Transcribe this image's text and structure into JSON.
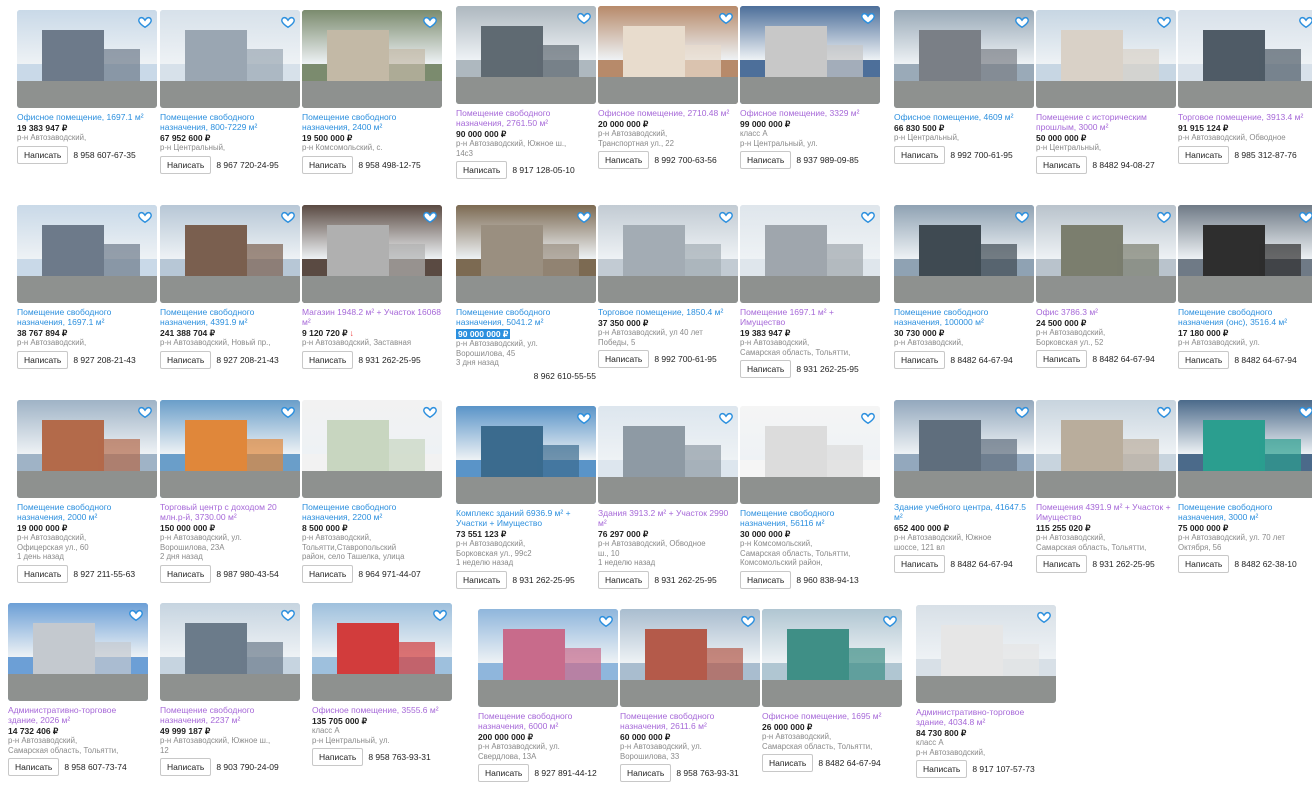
{
  "listings": [
    {
      "title": "Офисное помещение, 1697.1 м²",
      "price": "19 383 947 ₽",
      "meta": [
        "р-н Автозаводский,"
      ],
      "write": "Написать",
      "phone": "8 958 607-67-35",
      "visited": false
    },
    {
      "title": "Помещение свободного назначения, 800-7229 м²",
      "price": "67 952 600 ₽",
      "meta": [
        "р-н Центральный,"
      ],
      "write": "Написать",
      "phone": "8 967 720-24-95",
      "visited": false
    },
    {
      "title": "Помещение свободного назначения, 2400 м²",
      "price": "19 500 000 ₽",
      "meta": [
        "р-н Комсомольский, с."
      ],
      "write": "Написать",
      "phone": "8 958 498-12-75",
      "visited": false
    },
    {
      "title": "Помещение свободного назначения, 2761.50 м²",
      "price": "90 000 000 ₽",
      "meta": [
        "р-н Автозаводский, Южное ш.,",
        "14с3"
      ],
      "write": "Написать",
      "phone": "8 917 128-05-10",
      "visited": true
    },
    {
      "title": "Офисное помещение, 2710.48 м²",
      "price": "20 000 000 ₽",
      "meta": [
        "р-н Автозаводский,",
        "Транспортная ул., 22"
      ],
      "write": "Написать",
      "phone": "8 992 700-63-56",
      "visited": true
    },
    {
      "title": "Офисное помещение, 3329 м²",
      "price": "99 000 000 ₽",
      "meta": [
        "класс A",
        "р-н Центральный, ул."
      ],
      "write": "Написать",
      "phone": "8 937 989-09-85",
      "visited": true
    },
    {
      "title": "Офисное помещение, 4609 м²",
      "price": "66 830 500 ₽",
      "meta": [
        "р-н Центральный,"
      ],
      "write": "Написать",
      "phone": "8 992 700-61-95",
      "visited": false
    },
    {
      "title": "Помещение с историческим прошлым, 3000 м²",
      "price": "50 000 000 ₽",
      "meta": [
        "р-н Центральный,"
      ],
      "write": "Написать",
      "phone": "8 8482 94-08-27",
      "visited": true
    },
    {
      "title": "Торговое помещение, 3913.4 м²",
      "price": "91 915 124 ₽",
      "meta": [
        "р-н Автозаводский, Обводное"
      ],
      "write": "Написать",
      "phone": "8 985 312-87-76",
      "visited": true
    },
    {
      "title": "Помещение свободного назначения, 1697.1 м²",
      "price": "38 767 894 ₽",
      "meta": [
        "р-н Автозаводский,"
      ],
      "write": "Написать",
      "phone": "8 927 208-21-43",
      "visited": false
    },
    {
      "title": "Помещение свободного назначения, 4391.9 м²",
      "price": "241 388 704 ₽",
      "meta": [
        "р-н Автозаводский, Новый пр.,"
      ],
      "write": "Написать",
      "phone": "8 927 208-21-43",
      "visited": false
    },
    {
      "title": "Магазин 1948.2 м² + Участок 16068 м²",
      "price": "9 120 720 ₽",
      "drop": "↓",
      "meta": [
        "р-н Автозаводский, Заставная"
      ],
      "write": "Написать",
      "phone": "8 931 262-25-95",
      "visited": true
    },
    {
      "title": "Помещение свободного назначения, 5041.2 м²",
      "price": "90 000 000 ₽",
      "highlight": true,
      "meta": [
        "р-н Автозаводский, ул.",
        "Ворошилова, 45",
        "3 дня назад"
      ],
      "write": "",
      "phone": "8 962 610-55-55",
      "visited": false
    },
    {
      "title": "Торговое помещение, 1850.4 м²",
      "price": "37 350 000 ₽",
      "meta": [
        "р-н Автозаводский, ул 40 лет",
        "Победы, 5"
      ],
      "write": "Написать",
      "phone": "8 992 700-61-95",
      "visited": false
    },
    {
      "title": "Помещение 1697.1 м² + Имущество",
      "price": "19 383 947 ₽",
      "meta": [
        "р-н Автозаводский,",
        "Самарская область, Тольятти,"
      ],
      "write": "Написать",
      "phone": "8 931 262-25-95",
      "visited": true
    },
    {
      "title": "Помещение свободного назначения, 100000 м²",
      "price": "30 730 000 ₽",
      "meta": [
        "р-н Автозаводский,"
      ],
      "write": "Написать",
      "phone": "8 8482 64-67-94",
      "visited": false
    },
    {
      "title": "Офис 3786.3 м²",
      "price": "24 500 000 ₽",
      "meta": [
        "р-н Автозаводский,",
        "Борковская ул., 52"
      ],
      "write": "Написать",
      "phone": "8 8482 64-67-94",
      "visited": true
    },
    {
      "title": "Помещение свободного назначения (онс), 3516.4 м²",
      "price": "17 180 000 ₽",
      "meta": [
        "р-н Автозаводский, ул."
      ],
      "write": "Написать",
      "phone": "8 8482 64-67-94",
      "visited": false
    },
    {
      "title": "Помещение свободного назначения, 2000 м²",
      "price": "19 000 000 ₽",
      "meta": [
        "р-н Автозаводский,",
        "Офицерская ул., 60",
        "1 день назад"
      ],
      "write": "Написать",
      "phone": "8 927 211-55-63",
      "visited": false
    },
    {
      "title": "Торговый центр с доходом 20 млн.р-й, 3730.00 м²",
      "price": "150 000 000 ₽",
      "meta": [
        "р-н Автозаводский, ул.",
        "Ворошилова, 23А",
        "2 дня назад"
      ],
      "write": "Написать",
      "phone": "8 987 980-43-54",
      "visited": true
    },
    {
      "title": "Помещение свободного назначения, 2200 м²",
      "price": "8 500 000 ₽",
      "meta": [
        "р-н Автозаводский,",
        "Тольятти,Ставропольский",
        "район, село Ташелка, улица"
      ],
      "write": "Написать",
      "phone": "8 964 971-44-07",
      "visited": false
    },
    {
      "title": "Комплекс зданий 6936.9 м² + Участки + Имущество",
      "price": "73 551 123 ₽",
      "meta": [
        "р-н Автозаводский,",
        "Борковская ул., 99с2",
        "1 неделю назад"
      ],
      "write": "Написать",
      "phone": "8 931 262-25-95",
      "visited": false
    },
    {
      "title": "Здания 3913.2 м² + Участок 2990 м²",
      "price": "76 297 000 ₽",
      "meta": [
        "р-н Автозаводский, Обводное",
        "ш., 10",
        "1 неделю назад"
      ],
      "write": "Написать",
      "phone": "8 931 262-25-95",
      "visited": true
    },
    {
      "title": "Помещение свободного назначения, 56116 м²",
      "price": "30 000 000 ₽",
      "meta": [
        "р-н Комсомольский,",
        "Самарская область, Тольятти,",
        "Комсомольский район,"
      ],
      "write": "Написать",
      "phone": "8 960 838-94-13",
      "visited": false
    },
    {
      "title": "Здание учебного центра, 41647.5 м²",
      "price": "652 400 000 ₽",
      "meta": [
        "р-н Автозаводский, Южное",
        "шоссе, 121 вл"
      ],
      "write": "Написать",
      "phone": "8 8482 64-67-94",
      "visited": false
    },
    {
      "title": "Помещения 4391.9 м² + Участок + Имущество",
      "price": "115 255 020 ₽",
      "meta": [
        "р-н Автозаводский,",
        "Самарская область, Тольятти,"
      ],
      "write": "Написать",
      "phone": "8 931 262-25-95",
      "visited": true
    },
    {
      "title": "Помещение свободного назначения, 3000 м²",
      "price": "75 000 000 ₽",
      "meta": [
        "р-н Автозаводский, ул. 70 лет",
        "Октября, 56"
      ],
      "write": "Написать",
      "phone": "8 8482 62-38-10",
      "visited": false
    },
    {
      "title": "Административно-торговое здание, 2026 м²",
      "price": "14 732 406 ₽",
      "meta": [
        "р-н Автозаводский,",
        "Самарская область, Тольятти,"
      ],
      "write": "Написать",
      "phone": "8 958 607-73-74",
      "visited": true
    },
    {
      "title": "Помещение свободного назначения, 2237 м²",
      "price": "49 999 187 ₽",
      "meta": [
        "р-н Автозаводский, Южное ш.,",
        "12"
      ],
      "write": "Написать",
      "phone": "8 903 790-24-09",
      "visited": true
    },
    {
      "title": "Офисное помещение, 3555.6 м²",
      "price": "135 705 000 ₽",
      "meta": [
        "класс A",
        "р-н Центральный, ул."
      ],
      "write": "Написать",
      "phone": "8 958 763-93-31",
      "visited": true
    },
    {
      "title": "Помещение свободного назначения, 6000 м²",
      "price": "200 000 000 ₽",
      "meta": [
        "р-н Автозаводский, ул.",
        "Свердлова, 13А"
      ],
      "write": "Написать",
      "phone": "8 927 891-44-12",
      "visited": true
    },
    {
      "title": "Помещение свободного назначения, 2611.6 м²",
      "price": "60 000 000 ₽",
      "meta": [
        "р-н Автозаводский, ул.",
        "Ворошилова, 33"
      ],
      "write": "Написать",
      "phone": "8 958 763-93-31",
      "visited": true
    },
    {
      "title": "Офисное помещение, 1695 м²",
      "price": "26 000 000 ₽",
      "meta": [
        "р-н Автозаводский,",
        "Самарская область, Тольятти,"
      ],
      "write": "Написать",
      "phone": "8 8482 64-67-94",
      "visited": true
    },
    {
      "title": "Административно-торговое здание, 4034.8 м²",
      "price": "84 730 800 ₽",
      "meta": [
        "класс A",
        "р-н Автозаводский,"
      ],
      "write": "Написать",
      "phone": "8 917 107-57-73",
      "visited": true
    }
  ],
  "palette": {
    "link": "#2b8fde",
    "visited": "#a668d8",
    "heart": "#2b8fde",
    "muted": "#8a8a8a",
    "price_drop": "#e33"
  },
  "icons": {
    "favorite": "heart-icon",
    "price_drop": "arrow-down-icon"
  }
}
